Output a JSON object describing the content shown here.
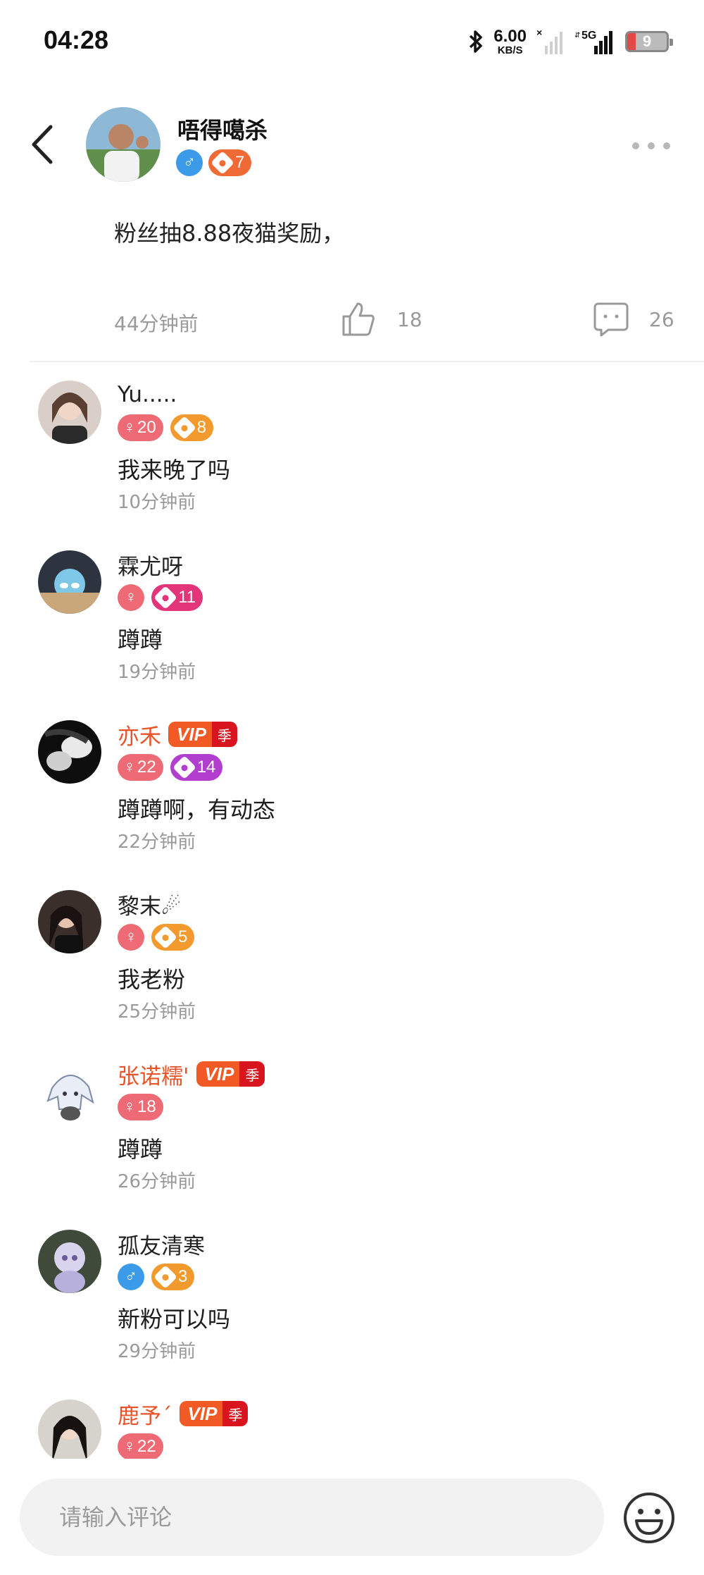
{
  "status_bar": {
    "time": "04:28",
    "net_speed_value": "6.00",
    "net_speed_unit": "KB/S",
    "network": "5G",
    "battery": "9"
  },
  "post": {
    "author_name": "唔得噶杀",
    "author_gender_symbol": "♂",
    "author_level": "7",
    "text": "粉丝抽8.88夜猫奖励，",
    "time": "44分钟前",
    "likes": "18",
    "comments": "26"
  },
  "comments": [
    {
      "name": "Yu.....",
      "vip": false,
      "gender_symbol": "♀",
      "age": "20",
      "level": "8",
      "level_color": "orange",
      "text": "我来晚了吗",
      "time": "10分钟前"
    },
    {
      "name": "霖尤呀",
      "vip": false,
      "gender_symbol": "♀",
      "age": "",
      "level": "11",
      "level_color": "pink",
      "text": "蹲蹲",
      "time": "19分钟前"
    },
    {
      "name": "亦禾",
      "vip": true,
      "gender_symbol": "♀",
      "age": "22",
      "level": "14",
      "level_color": "purple",
      "text": "蹲蹲啊，有动态",
      "time": "22分钟前"
    },
    {
      "name": "黎末☄",
      "vip": false,
      "gender_symbol": "♀",
      "age": "",
      "level": "5",
      "level_color": "orange",
      "text": "我老粉",
      "time": "25分钟前"
    },
    {
      "name": "张诺糯'",
      "vip": true,
      "gender_symbol": "♀",
      "age": "18",
      "level": "",
      "level_color": "",
      "text": "蹲蹲",
      "time": "26分钟前"
    },
    {
      "name": "孤友清寒",
      "vip": false,
      "gender_symbol": "♂",
      "age": "",
      "level": "3",
      "level_color": "orange",
      "text": "新粉可以吗",
      "time": "29分钟前"
    },
    {
      "name": "鹿予´",
      "vip": true,
      "gender_symbol": "♀",
      "age": "22",
      "level": "",
      "level_color": "",
      "text": "",
      "time": ""
    }
  ],
  "vip_label": {
    "left": "VIP",
    "right": "季"
  },
  "input": {
    "placeholder": "请输入评论"
  },
  "colors": {
    "vip_name": "#e8542a",
    "female": "#ee6a74",
    "male": "#3b9be8",
    "level_orange": "#f39a2e",
    "level_pink": "#e2357a",
    "level_purple": "#b23ecf"
  },
  "icons": [
    "back-arrow-icon",
    "more-icon",
    "like-icon",
    "comment-icon",
    "emoji-icon",
    "bluetooth-icon",
    "signal-icon",
    "battery-icon"
  ]
}
